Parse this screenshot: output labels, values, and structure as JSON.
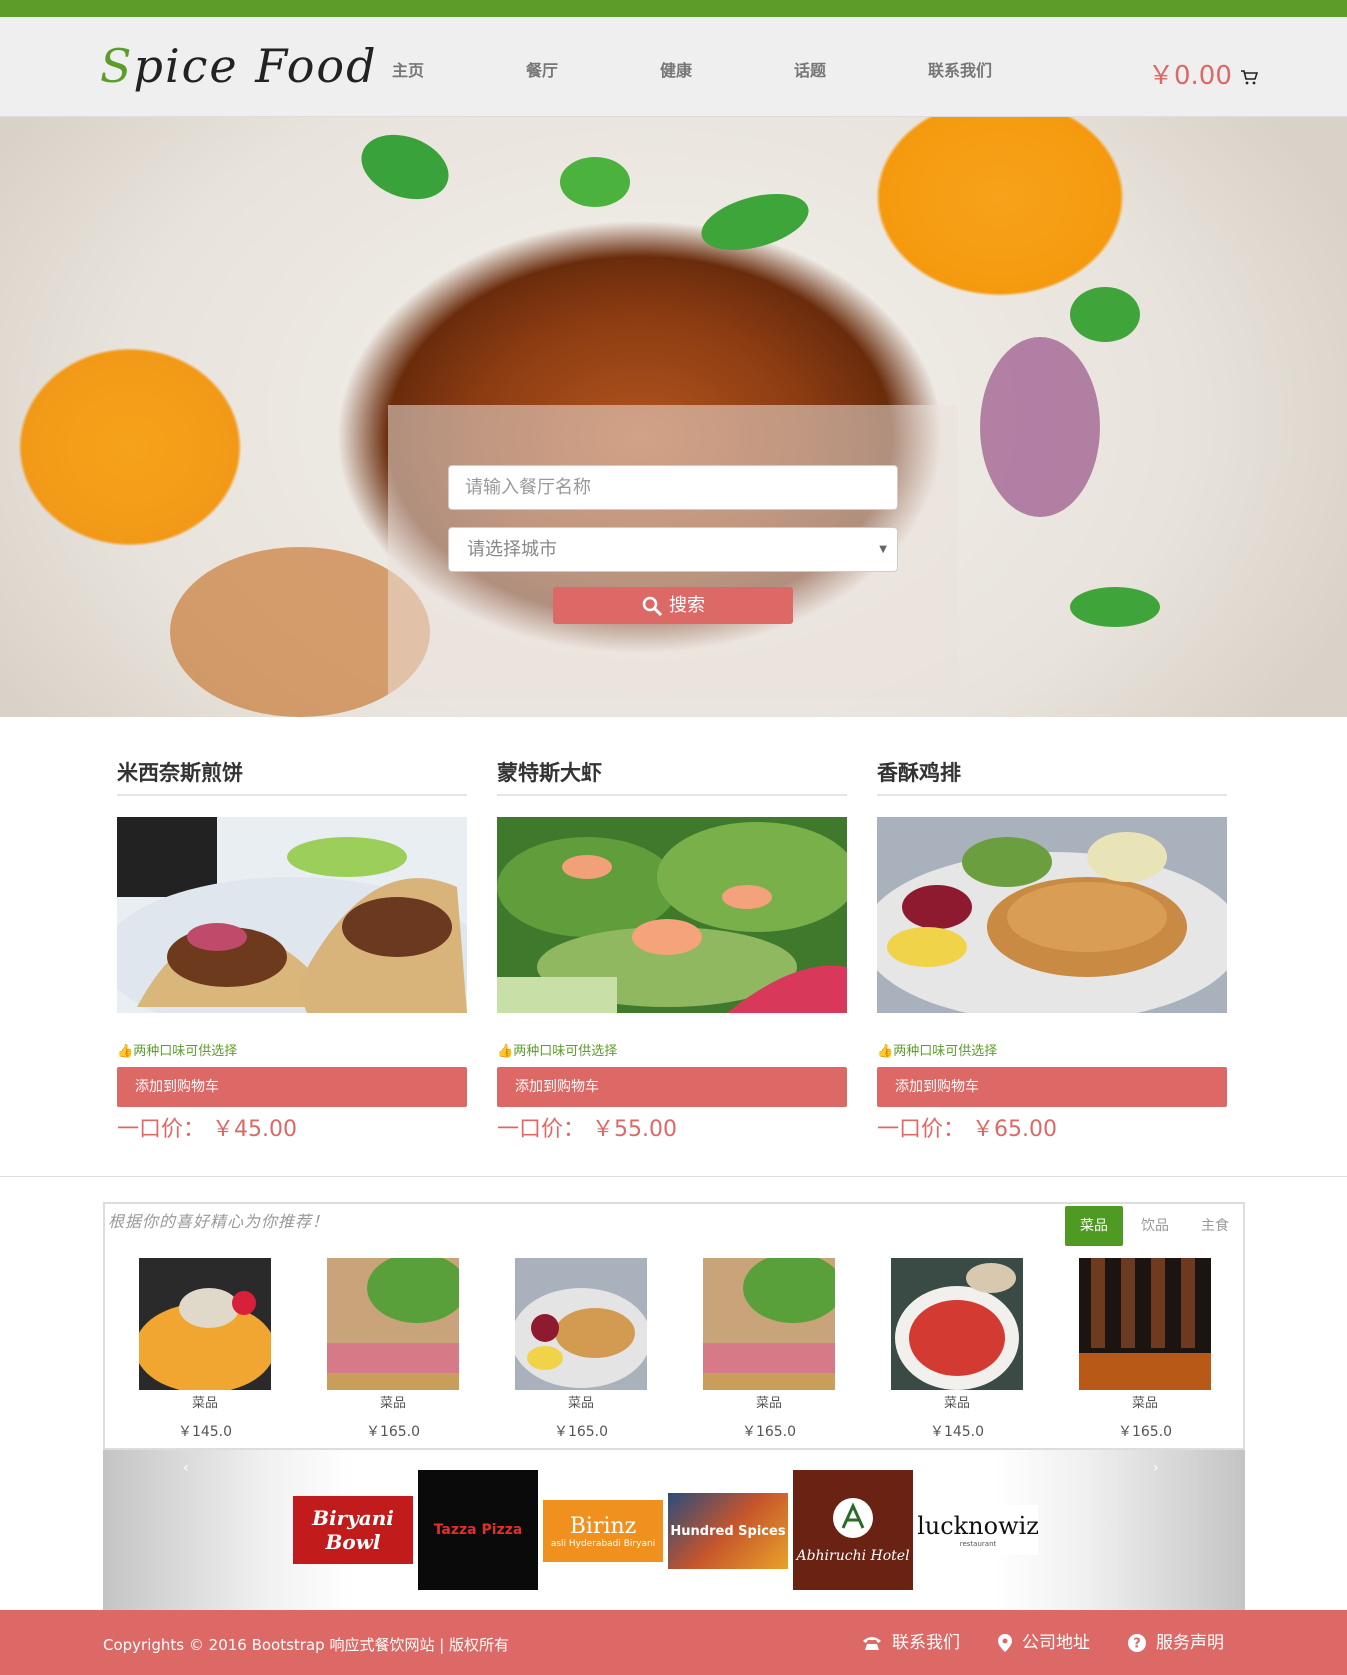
{
  "header": {
    "logo_initial_1": "S",
    "logo_rest_1": "pice",
    "logo_initial_2": "F",
    "logo_rest_2": "ood",
    "nav": [
      "主页",
      "餐厅",
      "健康",
      "话题",
      "联系我们"
    ],
    "cart_amount": "￥0.00",
    "cart_icon": "shopping-cart-icon"
  },
  "search": {
    "name_placeholder": "请输入餐厅名称",
    "city_placeholder": "请选择城市",
    "button_label": "搜索",
    "button_icon": "search-icon"
  },
  "featured": [
    {
      "title": "米西奈斯煎饼",
      "note": "两种口味可供选择",
      "button": "添加到购物车",
      "price_label": "一口价：",
      "price": "￥45.00"
    },
    {
      "title": "蒙特斯大虾",
      "note": "两种口味可供选择",
      "button": "添加到购物车",
      "price_label": "一口价：",
      "price": "￥55.00"
    },
    {
      "title": "香酥鸡排",
      "note": "两种口味可供选择",
      "button": "添加到购物车",
      "price_label": "一口价：",
      "price": "￥65.00"
    }
  ],
  "recommend": {
    "title": "根据你的喜好精心为你推荐！",
    "tabs": [
      "菜品",
      "饮品",
      "主食"
    ],
    "active_tab": "菜品",
    "items": [
      {
        "category": "菜品",
        "price": "￥145.0"
      },
      {
        "category": "菜品",
        "price": "￥165.0"
      },
      {
        "category": "菜品",
        "price": "￥165.0"
      },
      {
        "category": "菜品",
        "price": "￥165.0"
      },
      {
        "category": "菜品",
        "price": "￥145.0"
      },
      {
        "category": "菜品",
        "price": "￥165.0"
      }
    ]
  },
  "brands": {
    "prev": "‹",
    "next": "›",
    "logos": [
      {
        "name": "Biryani Bowl"
      },
      {
        "name": "Tazza Pizza"
      },
      {
        "name": "Birinz",
        "tagline": "asli Hyderabadi Biryani"
      },
      {
        "name": "Hundred Spices"
      },
      {
        "name": "Abhiruchi Hotel"
      },
      {
        "name": "lucknowiz",
        "tagline": "restaurant"
      }
    ]
  },
  "footer": {
    "copyright": "Copyrights © 2016 Bootstrap 响应式餐饮网站 | 版权所有",
    "links": [
      {
        "label": "联系我们",
        "icon": "phone-icon"
      },
      {
        "label": "公司地址",
        "icon": "location-pin-icon"
      },
      {
        "label": "服务声明",
        "icon": "question-circle-icon"
      }
    ]
  },
  "colors": {
    "brand_green": "#5c9d2a",
    "accent_red": "#dc6966",
    "header_bg": "#f0eff0"
  }
}
